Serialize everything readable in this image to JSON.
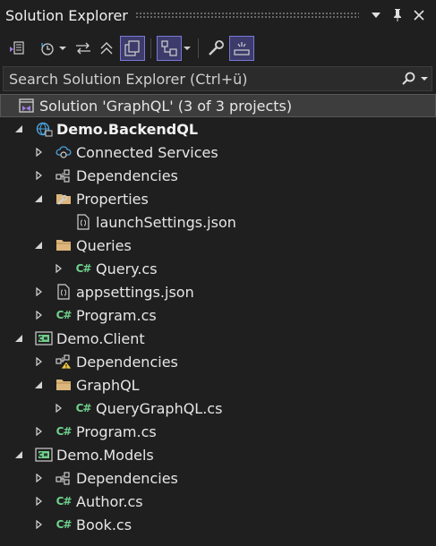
{
  "window": {
    "title": "Solution Explorer",
    "icons": [
      "dropdown-icon",
      "pin-icon",
      "close-icon"
    ]
  },
  "toolbar": {
    "icons": [
      "switch-views-icon",
      "history-icon",
      "sync-icon",
      "collapse-all-icon",
      "show-all-files-icon",
      "pending-changes-filter-icon",
      "properties-icon",
      "preview-selected-items-icon"
    ]
  },
  "search": {
    "placeholder": "Search Solution Explorer (Ctrl+ü)"
  },
  "tree": {
    "solution": "Solution 'GraphQL' (3 of 3 projects)",
    "backend": {
      "name": "Demo.BackendQL",
      "connected_services": "Connected Services",
      "dependencies": "Dependencies",
      "properties": "Properties",
      "launch_settings": "launchSettings.json",
      "queries": "Queries",
      "query_cs": "Query.cs",
      "appsettings": "appsettings.json",
      "program": "Program.cs"
    },
    "client": {
      "name": "Demo.Client",
      "dependencies": "Dependencies",
      "graphql": "GraphQL",
      "query_graphql": "QueryGraphQL.cs",
      "program": "Program.cs"
    },
    "models": {
      "name": "Demo.Models",
      "dependencies": "Dependencies",
      "author": "Author.cs",
      "book": "Book.cs"
    },
    "cs_badge": "C#"
  },
  "colors": {
    "background": "#1f1f1f",
    "selection": "#3d3d3d",
    "accent": "#7a78d8",
    "folder": "#dcb67a",
    "csharp": "#6fd08c",
    "web_project": "#4aa3df"
  }
}
